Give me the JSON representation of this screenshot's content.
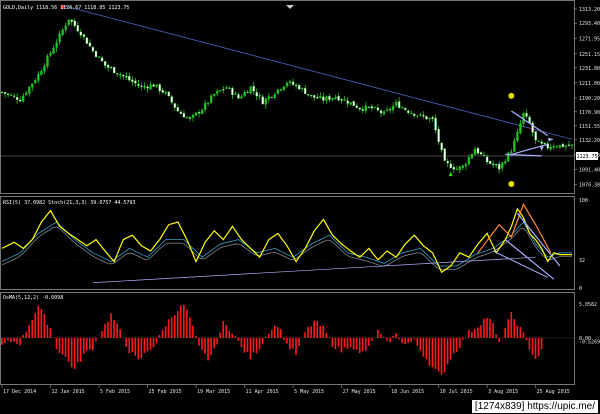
{
  "watermark": "[1274x839] https://upic.me/",
  "colors": {
    "background": "#000000",
    "grid": "#3a3a3a",
    "candle_up": "#22c322",
    "candle_down": "#ffffff",
    "rsi": "#ffff00",
    "stoch_main": "#3aa0c8",
    "stoch_signal": "#8899aa",
    "trend": "#4a5fbf",
    "hist": "#ff1a1a",
    "marker": "#e0e000",
    "orange": "#ff8a30",
    "wedge": "#aab0ff"
  },
  "chart_data": [
    {
      "type": "line",
      "title": "GOLD,Daily 1118.56 1126.67 1118.05 1123.75",
      "price_label": "1123.75",
      "yticks": [
        1313.2,
        1293.4,
        1271.95,
        1251.15,
        1231.8,
        1211.0,
        1190.2,
        1170.9,
        1151.55,
        1132.2,
        1111.4,
        1091.4,
        1070.3
      ],
      "ylim": [
        1060,
        1320
      ],
      "xlim": [
        0,
        188
      ],
      "x_tick_labels": [
        "17 Dec 2014",
        "12 Jan 2015",
        "5 Feb 2015",
        "25 Feb 2015",
        "19 Mar 2015",
        "11 Apr 2015",
        "5 May 2015",
        "27 May 2015",
        "18 Jun 2015",
        "10 Jul 2015",
        "3 Aug 2015",
        "25 Aug 2015"
      ],
      "x_tick_positions": [
        0,
        16,
        32,
        48,
        64,
        80,
        96,
        112,
        128,
        144,
        160,
        176
      ],
      "close_anchors": [
        [
          0,
          1198
        ],
        [
          6,
          1188
        ],
        [
          12,
          1222
        ],
        [
          18,
          1268
        ],
        [
          22,
          1300
        ],
        [
          26,
          1280
        ],
        [
          30,
          1255
        ],
        [
          34,
          1235
        ],
        [
          38,
          1225
        ],
        [
          42,
          1215
        ],
        [
          46,
          1205
        ],
        [
          50,
          1208
        ],
        [
          54,
          1196
        ],
        [
          58,
          1172
        ],
        [
          62,
          1160
        ],
        [
          66,
          1175
        ],
        [
          70,
          1195
        ],
        [
          74,
          1205
        ],
        [
          78,
          1190
        ],
        [
          82,
          1205
        ],
        [
          86,
          1185
        ],
        [
          90,
          1198
        ],
        [
          94,
          1212
        ],
        [
          98,
          1205
        ],
        [
          102,
          1192
        ],
        [
          106,
          1188
        ],
        [
          110,
          1192
        ],
        [
          114,
          1185
        ],
        [
          118,
          1176
        ],
        [
          122,
          1176
        ],
        [
          126,
          1168
        ],
        [
          130,
          1182
        ],
        [
          134,
          1172
        ],
        [
          138,
          1165
        ],
        [
          142,
          1160
        ],
        [
          146,
          1100
        ],
        [
          150,
          1092
        ],
        [
          152,
          1095
        ],
        [
          156,
          1120
        ],
        [
          160,
          1102
        ],
        [
          164,
          1093
        ],
        [
          168,
          1118
        ],
        [
          170,
          1140
        ],
        [
          172,
          1168
        ],
        [
          174,
          1155
        ],
        [
          176,
          1130
        ],
        [
          178,
          1125
        ],
        [
          180,
          1122
        ],
        [
          182,
          1125
        ],
        [
          184,
          1124
        ]
      ],
      "trendline": [
        [
          20,
          1318
        ],
        [
          188,
          1133
        ]
      ]
    },
    {
      "type": "line",
      "title": "RSI(5) 37.0982  Stoch(21,3,3) 39.0757 44.5793",
      "yticks": [
        100,
        32,
        0
      ],
      "ylim": [
        0,
        100
      ],
      "series": [
        {
          "anchors": [
            [
              0,
              45
            ],
            [
              4,
              52
            ],
            [
              7,
              45
            ],
            [
              10,
              55
            ],
            [
              13,
              75
            ],
            [
              16,
              88
            ],
            [
              19,
              70
            ],
            [
              22,
              62
            ],
            [
              25,
              55
            ],
            [
              28,
              48
            ],
            [
              31,
              55
            ],
            [
              34,
              42
            ],
            [
              37,
              30
            ],
            [
              40,
              55
            ],
            [
              43,
              60
            ],
            [
              46,
              48
            ],
            [
              49,
              42
            ],
            [
              52,
              55
            ],
            [
              55,
              72
            ],
            [
              58,
              75
            ],
            [
              61,
              55
            ],
            [
              64,
              30
            ],
            [
              67,
              52
            ],
            [
              70,
              65
            ],
            [
              73,
              55
            ],
            [
              76,
              70
            ],
            [
              79,
              55
            ],
            [
              82,
              45
            ],
            [
              85,
              35
            ],
            [
              88,
              55
            ],
            [
              91,
              62
            ],
            [
              94,
              48
            ],
            [
              97,
              30
            ],
            [
              100,
              45
            ],
            [
              103,
              65
            ],
            [
              106,
              78
            ],
            [
              109,
              60
            ],
            [
              112,
              50
            ],
            [
              115,
              42
            ],
            [
              118,
              35
            ],
            [
              121,
              45
            ],
            [
              124,
              32
            ],
            [
              127,
              42
            ],
            [
              130,
              35
            ],
            [
              133,
              50
            ],
            [
              136,
              60
            ],
            [
              139,
              48
            ],
            [
              142,
              40
            ],
            [
              145,
              18
            ],
            [
              148,
              25
            ],
            [
              151,
              40
            ],
            [
              154,
              35
            ],
            [
              157,
              50
            ],
            [
              160,
              62
            ],
            [
              163,
              40
            ],
            [
              166,
              55
            ],
            [
              168,
              70
            ],
            [
              170,
              90
            ],
            [
              172,
              80
            ],
            [
              174,
              62
            ],
            [
              176,
              55
            ],
            [
              178,
              45
            ],
            [
              180,
              30
            ],
            [
              182,
              40
            ],
            [
              184,
              38
            ]
          ]
        },
        {
          "anchors": [
            [
              0,
              30
            ],
            [
              6,
              40
            ],
            [
              12,
              62
            ],
            [
              18,
              75
            ],
            [
              24,
              55
            ],
            [
              30,
              40
            ],
            [
              36,
              30
            ],
            [
              42,
              45
            ],
            [
              48,
              35
            ],
            [
              54,
              55
            ],
            [
              60,
              55
            ],
            [
              66,
              35
            ],
            [
              72,
              50
            ],
            [
              78,
              55
            ],
            [
              84,
              40
            ],
            [
              90,
              45
            ],
            [
              96,
              35
            ],
            [
              102,
              50
            ],
            [
              108,
              60
            ],
            [
              114,
              40
            ],
            [
              120,
              35
            ],
            [
              126,
              28
            ],
            [
              132,
              40
            ],
            [
              138,
              45
            ],
            [
              144,
              25
            ],
            [
              150,
              25
            ],
            [
              156,
              38
            ],
            [
              162,
              45
            ],
            [
              168,
              60
            ],
            [
              172,
              75
            ],
            [
              176,
              50
            ],
            [
              180,
              35
            ],
            [
              184,
              40
            ]
          ]
        }
      ]
    },
    {
      "type": "bar",
      "title": "OsMA(5,12,2) -0.6098",
      "yticks": [
        5.0582,
        0.0,
        -0.5269
      ],
      "ylim": [
        -6.8,
        6.3
      ],
      "anchors": [
        [
          0,
          -1.2
        ],
        [
          3,
          -0.5
        ],
        [
          6,
          -0.8
        ],
        [
          9,
          2.0
        ],
        [
          12,
          4.8
        ],
        [
          14,
          3.2
        ],
        [
          16,
          1.5
        ],
        [
          18,
          -1.5
        ],
        [
          21,
          -3.0
        ],
        [
          24,
          -4.8
        ],
        [
          27,
          -2.5
        ],
        [
          30,
          -1.5
        ],
        [
          33,
          1.2
        ],
        [
          36,
          3.5
        ],
        [
          39,
          1.0
        ],
        [
          42,
          -2.0
        ],
        [
          45,
          -3.5
        ],
        [
          48,
          -2.0
        ],
        [
          51,
          -0.8
        ],
        [
          54,
          2.0
        ],
        [
          57,
          3.8
        ],
        [
          60,
          5.0
        ],
        [
          62,
          3.0
        ],
        [
          65,
          -1.5
        ],
        [
          68,
          -3.2
        ],
        [
          70,
          -2.0
        ],
        [
          73,
          2.2
        ],
        [
          76,
          1.0
        ],
        [
          79,
          -1.5
        ],
        [
          82,
          -3.0
        ],
        [
          85,
          -1.5
        ],
        [
          88,
          1.0
        ],
        [
          91,
          2.0
        ],
        [
          94,
          -1.0
        ],
        [
          97,
          -2.5
        ],
        [
          100,
          0.8
        ],
        [
          103,
          2.5
        ],
        [
          106,
          1.5
        ],
        [
          109,
          -1.0
        ],
        [
          112,
          -2.0
        ],
        [
          115,
          -1.0
        ],
        [
          118,
          -2.5
        ],
        [
          121,
          -1.5
        ],
        [
          124,
          1.0
        ],
        [
          127,
          -0.8
        ],
        [
          130,
          0.5
        ],
        [
          133,
          -1.0
        ],
        [
          136,
          -0.5
        ],
        [
          139,
          -2.5
        ],
        [
          142,
          -4.5
        ],
        [
          145,
          -5.8
        ],
        [
          148,
          -3.0
        ],
        [
          151,
          -1.2
        ],
        [
          154,
          0.8
        ],
        [
          157,
          1.8
        ],
        [
          160,
          3.2
        ],
        [
          162,
          2.0
        ],
        [
          164,
          -1.0
        ],
        [
          166,
          1.5
        ],
        [
          168,
          3.5
        ],
        [
          170,
          2.2
        ],
        [
          172,
          0.5
        ],
        [
          174,
          -1.5
        ],
        [
          176,
          -3.2
        ],
        [
          178,
          -2.0
        ],
        [
          180,
          -0.5
        ],
        [
          182,
          -0.7
        ],
        [
          184,
          -0.6
        ]
      ]
    }
  ]
}
